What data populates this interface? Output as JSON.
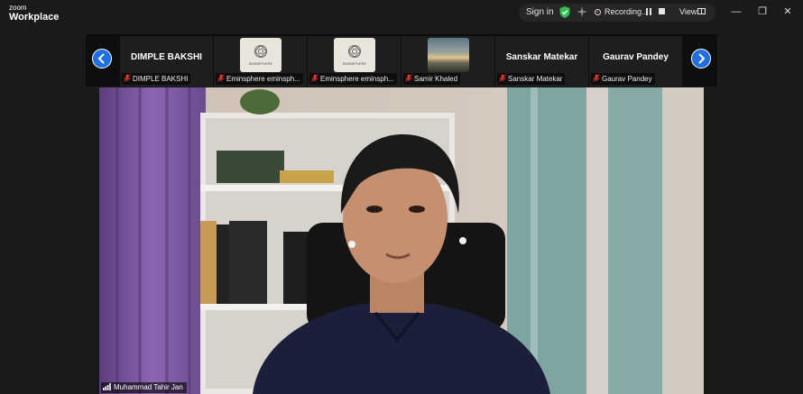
{
  "app": {
    "brand_top": "zoom",
    "brand_bottom": "Workplace"
  },
  "titlebar": {
    "sign_in": "Sign in",
    "recording_label": "Recording...",
    "view_label": "View",
    "window_buttons": {
      "minimize": "—",
      "restore": "❐",
      "close": "✕"
    }
  },
  "participant_strip": {
    "tiles": [
      {
        "display": "name",
        "name": "DIMPLE BAKSHI",
        "label": "DIMPLE BAKSHI",
        "muted": true
      },
      {
        "display": "logo",
        "logo_text": "EMINSPHERE",
        "label": "Eminsphere eminsph...",
        "muted": true
      },
      {
        "display": "logo",
        "logo_text": "EMINSPHERE",
        "label": "Eminsphere eminsph...",
        "muted": true
      },
      {
        "display": "photo",
        "label": "Samir Khaled",
        "muted": true
      },
      {
        "display": "name",
        "name": "Sanskar Matekar",
        "label": "Sanskar Matekar",
        "muted": true
      },
      {
        "display": "name",
        "name": "Gaurav Pandey",
        "label": "Gaurav Pandey",
        "muted": true
      }
    ]
  },
  "active_speaker": {
    "name": "Muhammad Tahir Jan"
  },
  "colors": {
    "accent": "#1f6fe0",
    "shield": "#2fbf4f",
    "mute": "#e53935",
    "recording": "#ee3333"
  }
}
